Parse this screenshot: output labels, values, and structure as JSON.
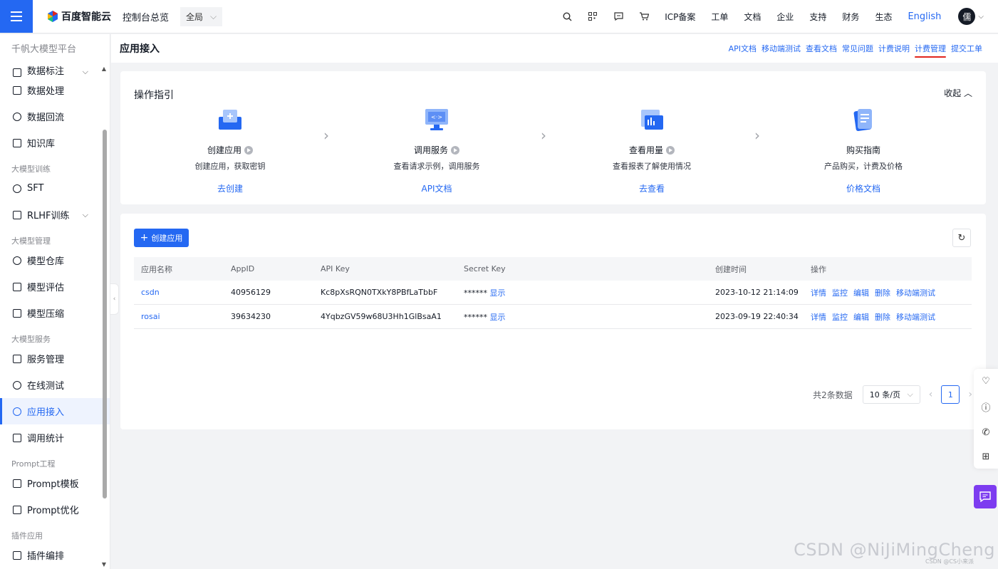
{
  "topbar": {
    "brand": "百度智能云",
    "console_link": "控制台总览",
    "scope": "全局",
    "nav": [
      "ICP备案",
      "工单",
      "文档",
      "企业",
      "支持",
      "财务",
      "生态"
    ],
    "language": "English",
    "avatar": "儒"
  },
  "sidebar": {
    "title": "千帆大模型平台",
    "items_top": [
      {
        "label": "数据标注",
        "icon": "tag-icon"
      },
      {
        "label": "数据处理",
        "icon": "data-process-icon"
      },
      {
        "label": "数据回流",
        "icon": "data-reflow-icon"
      },
      {
        "label": "知识库",
        "icon": "knowledge-icon"
      }
    ],
    "group_train": "大模型训练",
    "item_sft": "SFT",
    "item_rlhf": "RLHF训练",
    "group_manage": "大模型管理",
    "item_repo": "模型仓库",
    "item_eval": "模型评估",
    "item_compress": "模型压缩",
    "group_service": "大模型服务",
    "item_service_mgmt": "服务管理",
    "item_online_test": "在线测试",
    "item_app_access": "应用接入",
    "item_call_stats": "调用统计",
    "group_prompt": "Prompt工程",
    "item_prompt_tpl": "Prompt模板",
    "item_prompt_opt": "Prompt优化",
    "group_plugin": "插件应用",
    "item_plugin_edit": "插件编排"
  },
  "header": {
    "title": "应用接入",
    "links": [
      "API文档",
      "移动端测试",
      "查看文档",
      "常见问题",
      "计费说明",
      "计费管理",
      "提交工单"
    ]
  },
  "guide": {
    "title": "操作指引",
    "fold": "收起",
    "steps": [
      {
        "name": "创建应用",
        "desc": "创建应用，获取密钥",
        "link": "去创建"
      },
      {
        "name": "调用服务",
        "desc": "查看请求示例，调用服务",
        "link": "API文档"
      },
      {
        "name": "查看用量",
        "desc": "查看报表了解使用情况",
        "link": "去查看"
      },
      {
        "name": "购买指南",
        "desc": "产品购买，计费及价格",
        "link": "价格文档"
      }
    ]
  },
  "apps": {
    "create_label": "创建应用",
    "columns": [
      "应用名称",
      "AppID",
      "API Key",
      "Secret Key",
      "创建时间",
      "操作"
    ],
    "show_label": "显示",
    "masked": "******",
    "actions": [
      "详情",
      "监控",
      "编辑",
      "删除",
      "移动端测试"
    ],
    "rows": [
      {
        "name": "csdn",
        "app_id": "40956129",
        "api_key": "Kc8pXsRQN0TXkY8PBfLaTbbF",
        "created": "2023-10-12 21:14:09"
      },
      {
        "name": "rosai",
        "app_id": "39634230",
        "api_key": "4YqbzGV59w68U3Hh1GlBsaA1",
        "created": "2023-09-19 22:40:34"
      }
    ],
    "total": "共2条数据",
    "page_size": "10 条/页",
    "page": "1"
  },
  "watermark": "CSDN @NiJiMingCheng",
  "watermark_small": "CSDN @CS小来派",
  "colors": {
    "primary": "#2468f2",
    "accent_purple": "#7d3cf0",
    "underline_red": "#e0251d"
  }
}
